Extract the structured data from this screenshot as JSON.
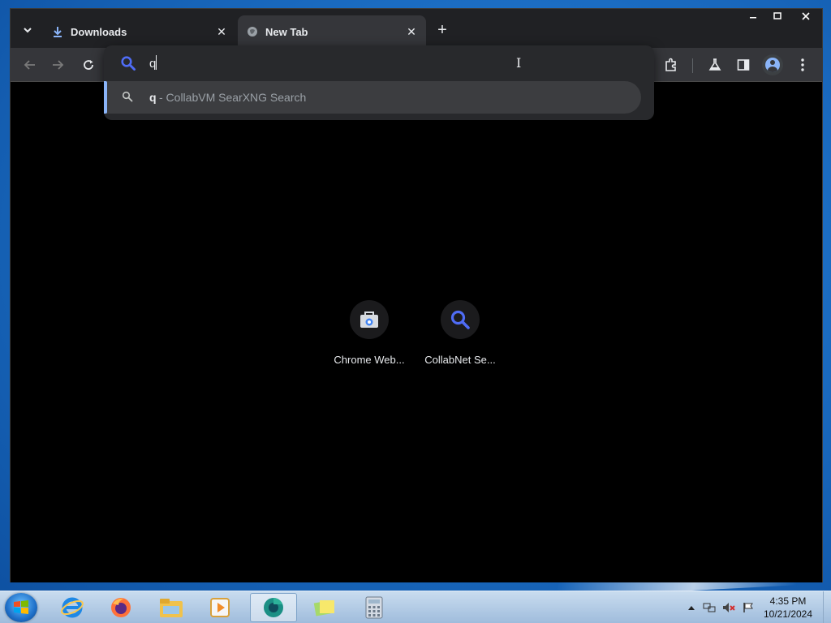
{
  "browser": {
    "tabs": [
      {
        "label": "Downloads",
        "icon": "download-icon",
        "active": false
      },
      {
        "label": "New Tab",
        "icon": "globe-icon",
        "active": true
      }
    ],
    "window_controls": {
      "minimize": "—",
      "maximize": "▢",
      "close": "✕"
    }
  },
  "omnibox": {
    "value": "q",
    "suggestion": {
      "query": "q",
      "description": " - CollabVM SearXNG Search"
    }
  },
  "ntp": {
    "tiles": [
      {
        "label": "Chrome Web...",
        "icon": "chrome-web-store-icon"
      },
      {
        "label": "CollabNet Se...",
        "icon": "search-icon"
      }
    ]
  },
  "taskbar": {
    "apps": [
      "internet-explorer-icon",
      "firefox-icon",
      "file-explorer-icon",
      "media-player-icon",
      "chrome-icon",
      "sticky-notes-icon",
      "calculator-icon"
    ],
    "time": "4:35 PM",
    "date": "10/21/2024"
  },
  "colors": {
    "accent": "#8ab4f8",
    "search_blue": "#4f6cf5",
    "chrome_dark": "#35363a"
  }
}
